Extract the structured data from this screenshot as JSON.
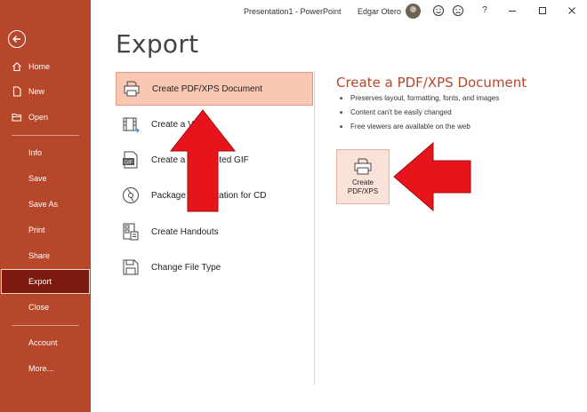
{
  "titlebar": {
    "title": "Presentation1  -  PowerPoint",
    "user": "Edgar Otero",
    "icons": [
      "smiley-icon",
      "frown-icon",
      "help-icon",
      "minimize-icon",
      "maximize-icon",
      "close-icon"
    ],
    "help_glyph": "?"
  },
  "sidebar": {
    "back_icon": "back-arrow-icon",
    "items": [
      {
        "label": "Home",
        "icon": "home-icon"
      },
      {
        "label": "New",
        "icon": "new-doc-icon"
      },
      {
        "label": "Open",
        "icon": "folder-icon"
      },
      {
        "label": "Info"
      },
      {
        "label": "Save"
      },
      {
        "label": "Save As"
      },
      {
        "label": "Print"
      },
      {
        "label": "Share"
      },
      {
        "label": "Export",
        "active": true
      },
      {
        "label": "Close"
      },
      {
        "label": "Account"
      },
      {
        "label": "More..."
      }
    ],
    "color": "#b7472a",
    "active_color": "#7c1a10"
  },
  "main": {
    "title": "Export",
    "options": [
      {
        "label": "Create PDF/XPS Document",
        "icon": "pdf-xps-icon",
        "selected": true
      },
      {
        "label": "Create a V",
        "icon": "video-icon"
      },
      {
        "label": "Create a",
        "label_tail": "ted GIF",
        "icon": "gif-icon"
      },
      {
        "label": "Package Presentation for CD",
        "icon": "cd-icon"
      },
      {
        "label": "Create Handouts",
        "icon": "handouts-icon"
      },
      {
        "label": "Change File Type",
        "icon": "file-type-icon"
      }
    ]
  },
  "panel": {
    "title": "Create a PDF/XPS Document",
    "bullets": [
      "Preserves layout, formatting, fonts, and images",
      "Content can't be easily changed",
      "Free viewers are available on the web"
    ],
    "button_line1": "Create",
    "button_line2": "PDF/XPS",
    "accent": "#b7472a"
  },
  "annotations": {
    "arrow_color": "#e8141c"
  }
}
